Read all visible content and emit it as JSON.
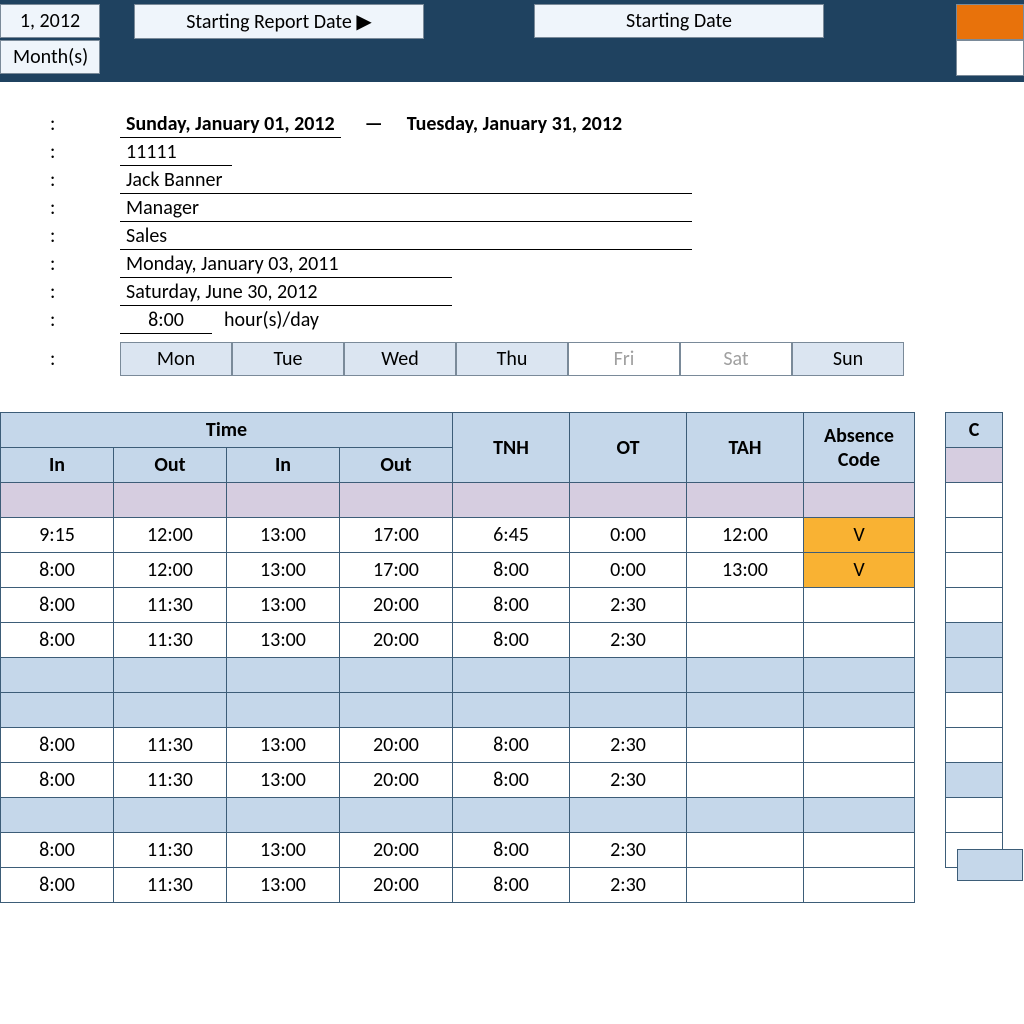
{
  "topbar": {
    "date1": "1, 2012",
    "starting_report_label": "Starting Report Date ▶",
    "starting_date_label": "Starting Date",
    "months_label": "Month(s)"
  },
  "info": {
    "period_start": "Sunday, January 01, 2012",
    "period_end": "Tuesday, January 31, 2012",
    "dash": "—",
    "employee_id": "11111",
    "employee_name": "Jack Banner",
    "position": "Manager",
    "department": "Sales",
    "hire_date": "Monday, January 03, 2011",
    "end_date": "Saturday, June 30, 2012",
    "hours_value": "8:00",
    "hours_label": "hour(s)/day"
  },
  "days": [
    {
      "label": "Mon",
      "on": true
    },
    {
      "label": "Tue",
      "on": true
    },
    {
      "label": "Wed",
      "on": true
    },
    {
      "label": "Thu",
      "on": true
    },
    {
      "label": "Fri",
      "on": false
    },
    {
      "label": "Sat",
      "on": false
    },
    {
      "label": "Sun",
      "on": true
    }
  ],
  "headers": {
    "time": "Time",
    "in": "In",
    "out": "Out",
    "tnh": "TNH",
    "ot": "OT",
    "tah": "TAH",
    "absence": "Absence Code",
    "side": "C"
  },
  "rows": [
    {
      "cls": "alt-purple",
      "in1": "",
      "out1": "",
      "in2": "",
      "out2": "",
      "tnh": "",
      "ot": "",
      "tah": "",
      "abs": "",
      "abscls": ""
    },
    {
      "cls": "",
      "in1": "9:15",
      "out1": "12:00",
      "in2": "13:00",
      "out2": "17:00",
      "tnh": "6:45",
      "ot": "0:00",
      "tah": "12:00",
      "abs": "V",
      "abscls": "yellow"
    },
    {
      "cls": "",
      "in1": "8:00",
      "out1": "12:00",
      "in2": "13:00",
      "out2": "17:00",
      "tnh": "8:00",
      "ot": "0:00",
      "tah": "13:00",
      "abs": "V",
      "abscls": "yellow"
    },
    {
      "cls": "",
      "in1": "8:00",
      "out1": "11:30",
      "in2": "13:00",
      "out2": "20:00",
      "tnh": "8:00",
      "ot": "2:30",
      "tah": "",
      "abs": "",
      "abscls": ""
    },
    {
      "cls": "",
      "in1": "8:00",
      "out1": "11:30",
      "in2": "13:00",
      "out2": "20:00",
      "tnh": "8:00",
      "ot": "2:30",
      "tah": "",
      "abs": "",
      "abscls": ""
    },
    {
      "cls": "alt",
      "in1": "",
      "out1": "",
      "in2": "",
      "out2": "",
      "tnh": "",
      "ot": "",
      "tah": "",
      "abs": "",
      "abscls": ""
    },
    {
      "cls": "alt",
      "in1": "",
      "out1": "",
      "in2": "",
      "out2": "",
      "tnh": "",
      "ot": "",
      "tah": "",
      "abs": "",
      "abscls": ""
    },
    {
      "cls": "",
      "in1": "8:00",
      "out1": "11:30",
      "in2": "13:00",
      "out2": "20:00",
      "tnh": "8:00",
      "ot": "2:30",
      "tah": "",
      "abs": "",
      "abscls": ""
    },
    {
      "cls": "",
      "in1": "8:00",
      "out1": "11:30",
      "in2": "13:00",
      "out2": "20:00",
      "tnh": "8:00",
      "ot": "2:30",
      "tah": "",
      "abs": "",
      "abscls": ""
    },
    {
      "cls": "alt",
      "in1": "",
      "out1": "",
      "in2": "",
      "out2": "",
      "tnh": "",
      "ot": "",
      "tah": "",
      "abs": "",
      "abscls": ""
    },
    {
      "cls": "",
      "in1": "8:00",
      "out1": "11:30",
      "in2": "13:00",
      "out2": "20:00",
      "tnh": "8:00",
      "ot": "2:30",
      "tah": "",
      "abs": "",
      "abscls": ""
    },
    {
      "cls": "",
      "in1": "8:00",
      "out1": "11:30",
      "in2": "13:00",
      "out2": "20:00",
      "tnh": "8:00",
      "ot": "2:30",
      "tah": "",
      "abs": "",
      "abscls": ""
    }
  ]
}
